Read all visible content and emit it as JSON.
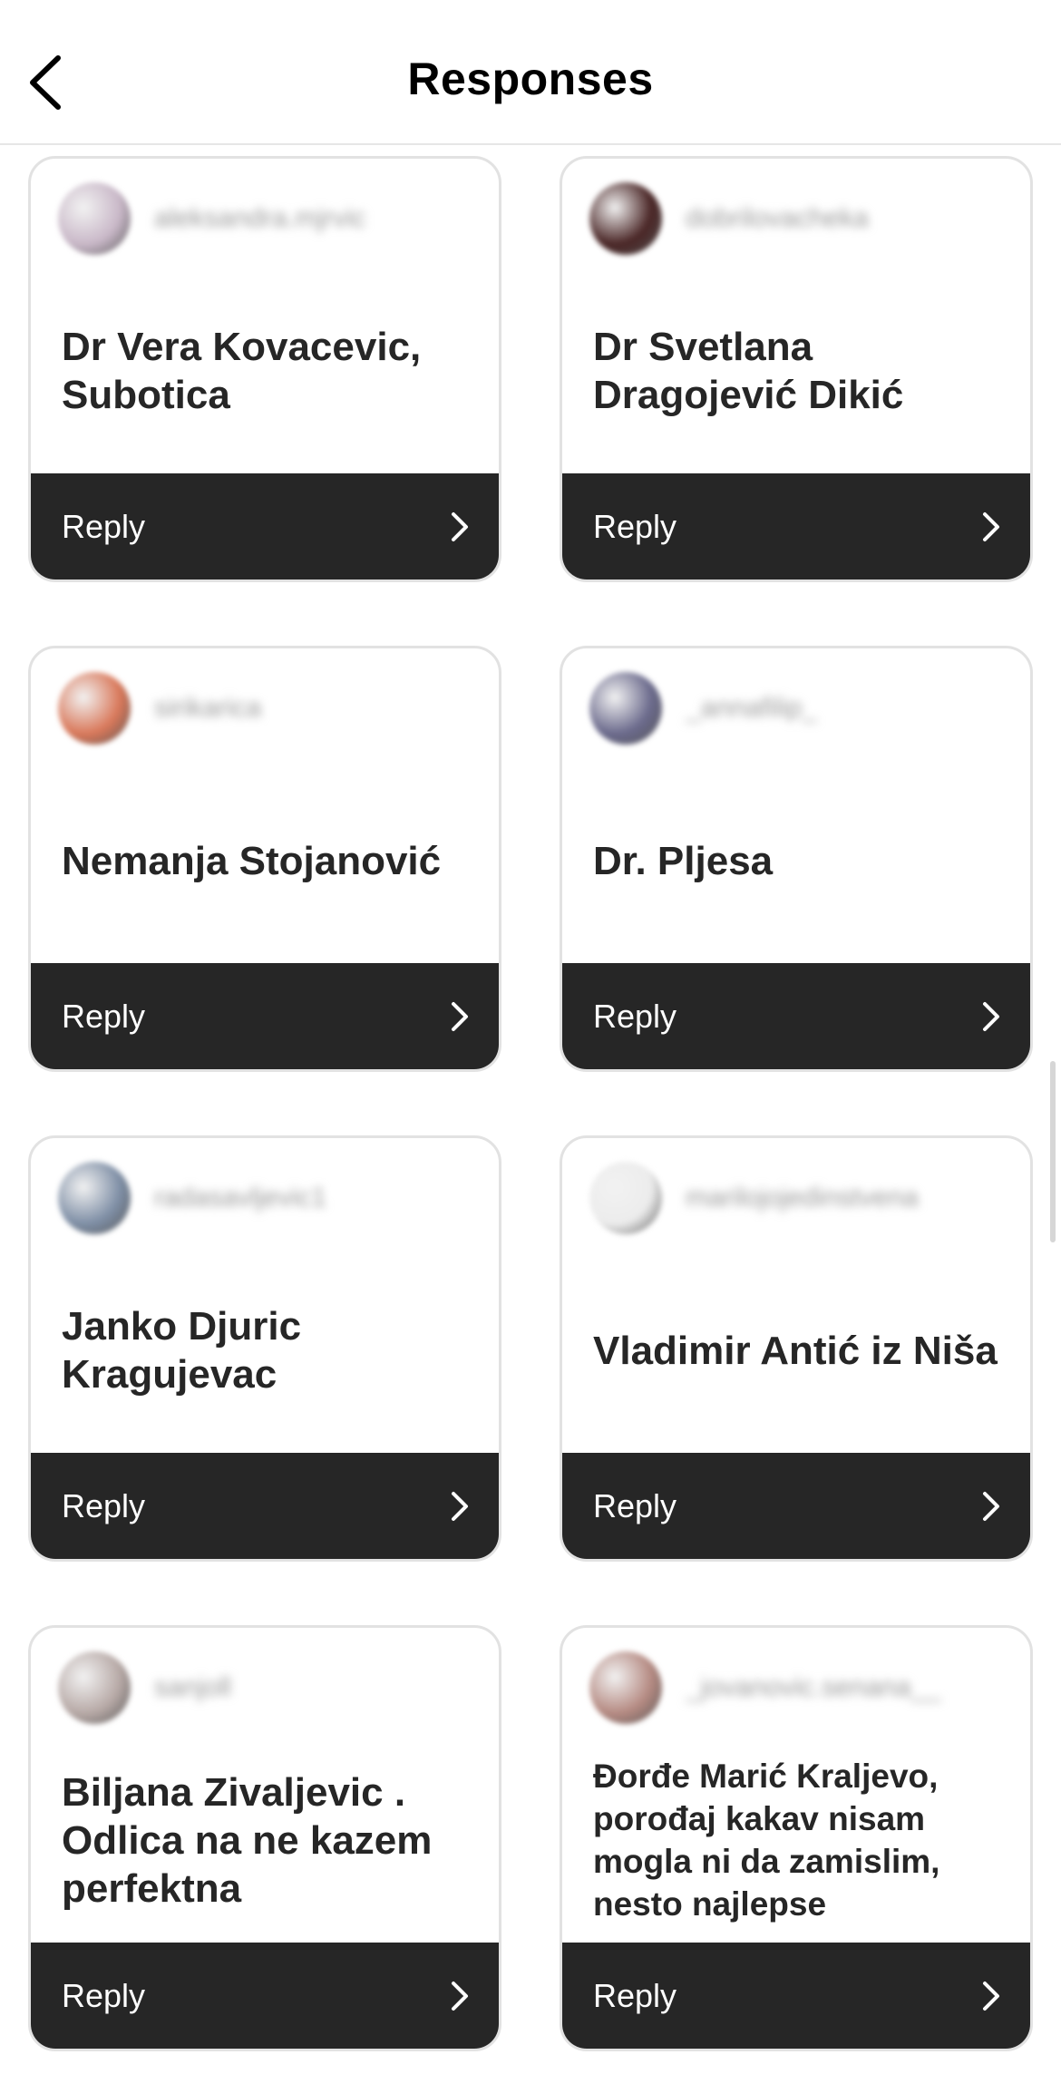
{
  "header": {
    "title": "Responses"
  },
  "cards": [
    {
      "username": "aleksandra.mjrvic",
      "avatar_color": "#c9b8c8",
      "response": "Dr Vera Kovacevic, Subotica",
      "reply_label": "Reply"
    },
    {
      "username": "dobrilovacheka",
      "avatar_color": "#4a2626",
      "response": "Dr Svetlana Dragojević Dikić",
      "reply_label": "Reply"
    },
    {
      "username": "sirikarica",
      "avatar_color": "#d9785a",
      "response": "Nemanja Stojanović",
      "reply_label": "Reply"
    },
    {
      "username": "_annafilip_",
      "avatar_color": "#6b6a8c",
      "response": "Dr. Pljesa",
      "reply_label": "Reply"
    },
    {
      "username": "radasavljevic1",
      "avatar_color": "#7f8fa6",
      "response": "Janko Djuric Kragujevac",
      "reply_label": "Reply"
    },
    {
      "username": "marilojojedinstvena",
      "avatar_color": "#ececec",
      "response": "Vladimir Antić iz Niša",
      "reply_label": "Reply"
    },
    {
      "username": "sanjoll",
      "avatar_color": "#b7a9a6",
      "response": "Biljana Zivaljevic . Odlica na ne kazem perfektna",
      "reply_label": "Reply"
    },
    {
      "username": "_jovanovic.senana__",
      "avatar_color": "#b58a82",
      "response": "Đorđe Marić Kraljevo, porođaj kakav nisam mogla ni da zamislim, nesto najlepse",
      "reply_label": "Reply"
    }
  ]
}
